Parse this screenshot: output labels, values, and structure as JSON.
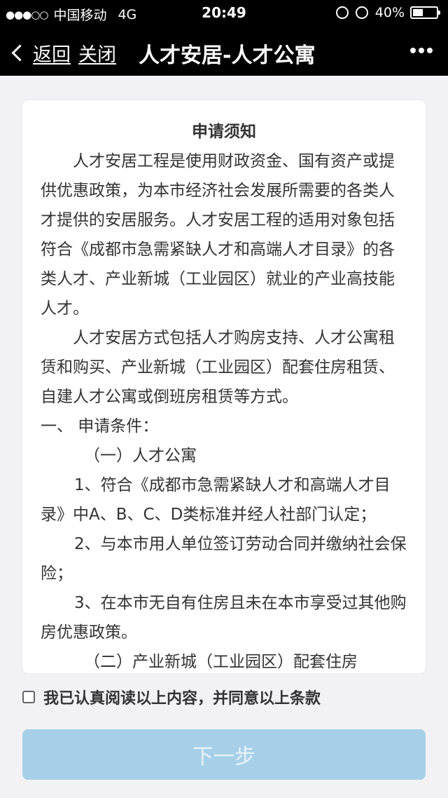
{
  "status": {
    "signal": "●●●○○",
    "carrier": "中国移动",
    "network": "4G",
    "time": "20:49",
    "battery": "40%"
  },
  "nav": {
    "back_label": "返回",
    "close_label": "关闭",
    "title": "人才安居-人才公寓"
  },
  "notice": {
    "heading": "申请须知",
    "paragraphs": [
      "人才安居工程是使用财政资金、国有资产或提供优惠政策，为本市经济社会发展所需要的各类人才提供的安居服务。人才安居工程的适用对象包括符合《成都市急需紧缺人才和高端人才目录》的各类人才、产业新城（工业园区）就业的产业高技能人才。",
      "人才安居方式包括人才购房支持、人才公寓租赁和购买、产业新城（工业园区）配套住房租赁、自建人才公寓或倒班房租赁等方式。",
      "一、 申请条件：",
      "（一）人才公寓",
      "1、符合《成都市急需紧缺人才和高端人才目录》中A、B、C、D类标准并经人社部门认定；",
      "2、与本市用人单位签订劳动合同并缴纳社会保险；",
      "3、在本市无自有住房且未在本市享受过其他购房优惠政策。",
      "（二）产业新城（工业园区）配套住房"
    ]
  },
  "agree_label": "我已认真阅读以上内容，并同意以上条款",
  "next_label": "下一步",
  "colors": {
    "nav_bg": "#000000",
    "page_bg": "#f2f2f5",
    "button_disabled": "#a7cfe8"
  }
}
